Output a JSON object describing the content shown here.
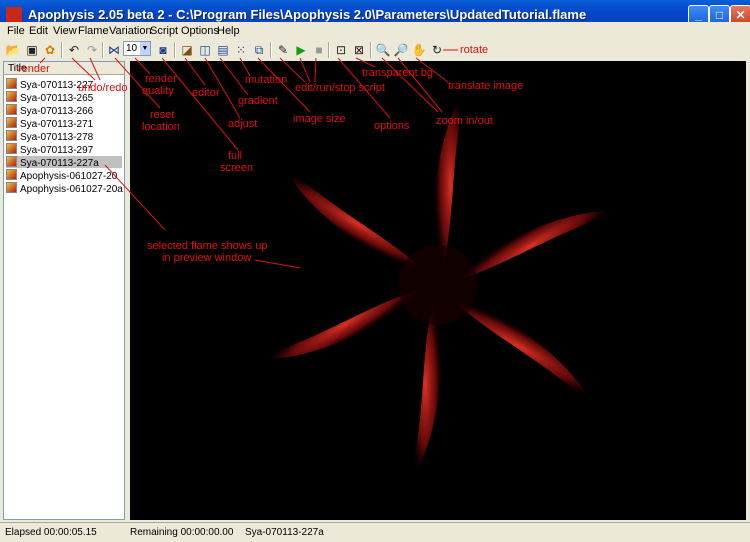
{
  "window": {
    "title": "Apophysis 2.05 beta 2 - C:\\Program Files\\Apophysis 2.0\\Parameters\\UpdatedTutorial.flame"
  },
  "menu": [
    "File",
    "Edit",
    "View",
    "Flame",
    "Variation",
    "Script",
    "Options",
    "Help"
  ],
  "toolbar": {
    "quality_value": "10"
  },
  "list": {
    "header": "Title",
    "items": [
      "Sya-070113-227",
      "Sya-070113-265",
      "Sya-070113-266",
      "Sya-070113-271",
      "Sya-070113-278",
      "Sya-070113-297",
      "Sya-070113-227a",
      "Apophysis-061027-20",
      "Apophysis-061027-20a"
    ],
    "selected_index": 6
  },
  "status": {
    "elapsed": "Elapsed 00:00:05.15",
    "remaining": "Remaining 00:00:00.00",
    "flame": "Sya-070113-227a"
  },
  "annotations": {
    "render": "render",
    "undo_redo": "undo/redo",
    "render_quality_1": "render",
    "render_quality_2": "quality",
    "reset_location_1": "reset",
    "reset_location_2": "location",
    "full_screen_1": "full",
    "full_screen_2": "screen",
    "editor": "editor",
    "adjust": "adjust",
    "gradient": "gradient",
    "mutation": "mutation",
    "image_size": "image size",
    "script": "edit/run/stop script",
    "transparent": "transparent bg",
    "options": "options",
    "zoom": "zoom in/out",
    "translate": "translate image",
    "rotate": "rotate",
    "selected_1": "selected flame shows up",
    "selected_2": "in preview window"
  },
  "colors": {
    "annotation": "#e01010",
    "flame": "#e02020",
    "titlebar": "#0447c9"
  }
}
